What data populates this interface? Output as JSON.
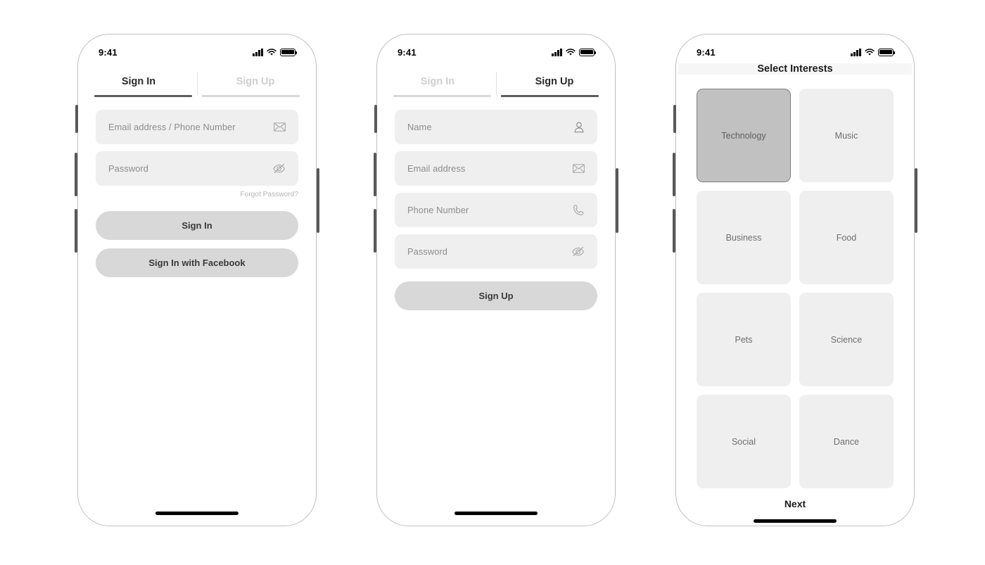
{
  "statusbar": {
    "time": "9:41",
    "signal_icon": "signal-bars-icon",
    "wifi_icon": "wifi-icon",
    "battery_icon": "battery-full-icon"
  },
  "screens": [
    {
      "id": "sign-in",
      "tabs": [
        {
          "label": "Sign In",
          "active": true
        },
        {
          "label": "Sign Up",
          "active": false
        }
      ],
      "fields": [
        {
          "placeholder": "Email address / Phone Number",
          "icon": "envelope-icon"
        },
        {
          "placeholder": "Password",
          "icon": "eye-slash-icon"
        }
      ],
      "forgot_password": "Forgot Password?",
      "buttons": [
        {
          "label": "Sign In"
        },
        {
          "label": "Sign In with Facebook"
        }
      ]
    },
    {
      "id": "sign-up",
      "tabs": [
        {
          "label": "Sign In",
          "active": false
        },
        {
          "label": "Sign Up",
          "active": true
        }
      ],
      "fields": [
        {
          "placeholder": "Name",
          "icon": "person-icon"
        },
        {
          "placeholder": "Email address",
          "icon": "envelope-icon"
        },
        {
          "placeholder": "Phone Number",
          "icon": "phone-handset-icon"
        },
        {
          "placeholder": "Password",
          "icon": "eye-slash-icon"
        }
      ],
      "buttons": [
        {
          "label": "Sign Up"
        }
      ]
    },
    {
      "id": "select-interests",
      "title": "Select Interests",
      "tiles": [
        {
          "label": "Technology",
          "selected": true
        },
        {
          "label": "Music",
          "selected": false
        },
        {
          "label": "Business",
          "selected": false
        },
        {
          "label": "Food",
          "selected": false
        },
        {
          "label": "Pets",
          "selected": false
        },
        {
          "label": "Science",
          "selected": false
        },
        {
          "label": "Social",
          "selected": false
        },
        {
          "label": "Dance",
          "selected": false
        }
      ],
      "next_label": "Next"
    }
  ],
  "colors": {
    "field_bg": "#efefef",
    "pill_bg": "#d8d8d8",
    "tile_bg": "#efefef",
    "tile_selected_bg": "#c1c1c1",
    "tile_selected_border": "#7e7e7e",
    "active_underline": "#5d5d5d",
    "inactive_underline": "#d8d8d8",
    "header_bg": "#f6f6f6",
    "frame_border": "#bfbfbf",
    "muted_text": "#8c8c8c"
  }
}
